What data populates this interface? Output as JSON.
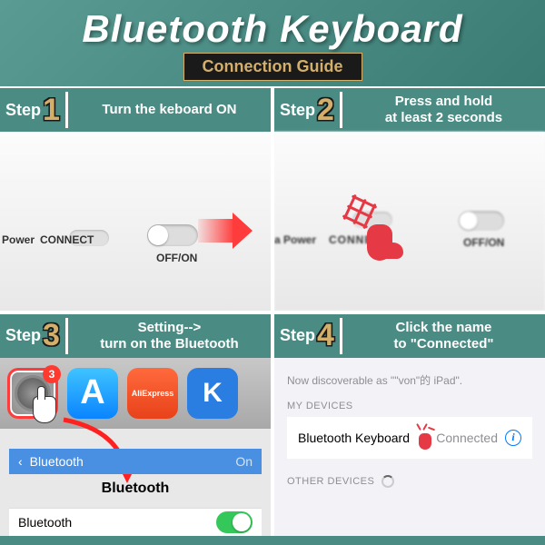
{
  "header": {
    "title": "Bluetooth Keyboard",
    "subtitle": "Connection Guide"
  },
  "steps": [
    {
      "label": "Step",
      "number": "1",
      "instruction": "Turn the keboard ON",
      "keyboard": {
        "power": "Power",
        "connect": "CONNECT",
        "offon": "OFF/ON"
      }
    },
    {
      "label": "Step",
      "number": "2",
      "instruction": "Press and hold\nat least 2 seconds",
      "keyboard": {
        "power": "a Power",
        "connect": "CONNECT",
        "offon": "OFF/ON"
      }
    },
    {
      "label": "Step",
      "number": "3",
      "instruction": "Setting-->\nturn on the Bluetooth",
      "apps": {
        "badge": "3",
        "aliexpress": "AliExpress",
        "k": "K"
      },
      "bluetooth": {
        "header": "Bluetooth",
        "on": "On",
        "title": "Bluetooth",
        "row": "Bluetooth"
      }
    },
    {
      "label": "Step",
      "number": "4",
      "instruction": "Click the name\nto \"Connected\"",
      "settings": {
        "discoverable": "Now discoverable as \"\"von\"的 iPad\".",
        "my_devices": "MY DEVICES",
        "device_name": "Bluetooth  Keyboard",
        "device_status": "Connected",
        "other_devices": "OTHER DEVICES"
      }
    }
  ]
}
